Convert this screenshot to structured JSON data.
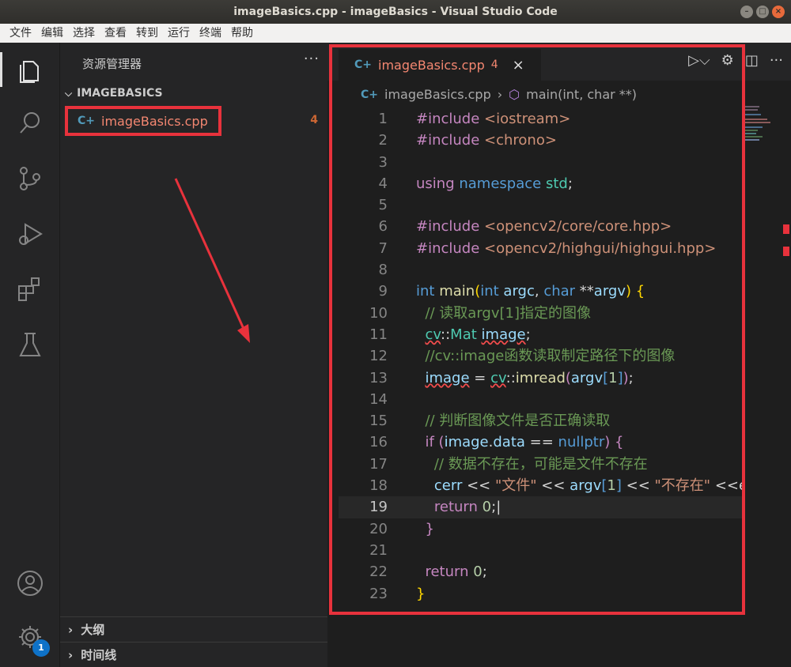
{
  "window": {
    "title": "imageBasics.cpp - imageBasics - Visual Studio Code"
  },
  "menu": [
    "文件",
    "编辑",
    "选择",
    "查看",
    "转到",
    "运行",
    "终端",
    "帮助"
  ],
  "activity": {
    "items": [
      "explorer-icon",
      "search-icon",
      "source-control-icon",
      "run-debug-icon",
      "extensions-icon",
      "testing-icon"
    ],
    "bottom": [
      "account-icon",
      "settings-gear-icon"
    ],
    "settings_badge": "1"
  },
  "sidebar": {
    "title": "资源管理器",
    "more": "···",
    "project": "IMAGEBASICS",
    "file": {
      "name": "imageBasics.cpp",
      "problems": "4"
    },
    "sections": [
      "大纲",
      "时间线"
    ]
  },
  "editor": {
    "tab": {
      "label": "imageBasics.cpp",
      "problems": "4",
      "close": "×"
    },
    "breadcrumb": {
      "file": "imageBasics.cpp",
      "symbol": "main(int, char **)"
    },
    "active_line": 19,
    "lines": [
      1,
      2,
      3,
      4,
      5,
      6,
      7,
      8,
      9,
      10,
      11,
      12,
      13,
      14,
      15,
      16,
      17,
      18,
      19,
      20,
      21,
      22,
      23
    ]
  },
  "colors": {
    "highlight_frame": "#e8323c",
    "keyword": "#c586c0",
    "string": "#ce9178",
    "comment": "#6a9955"
  }
}
